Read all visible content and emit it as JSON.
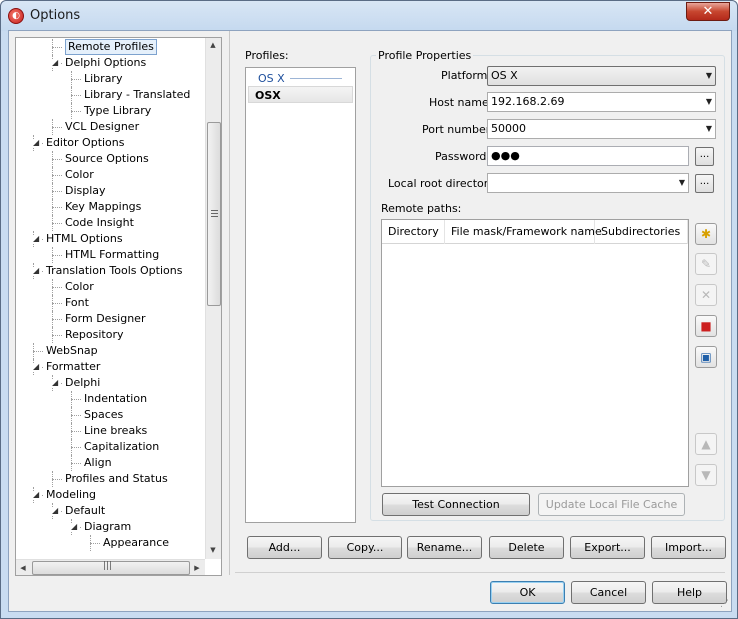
{
  "window": {
    "title": "Options",
    "app_icon": "delphi-logo-icon",
    "close_glyph": "✕"
  },
  "tree": {
    "items": [
      {
        "label": "Remote Profiles",
        "level": 2,
        "toggle": "",
        "selected": true
      },
      {
        "label": "Delphi Options",
        "level": 2,
        "toggle": "expanded"
      },
      {
        "label": "Library",
        "level": 3,
        "toggle": ""
      },
      {
        "label": "Library - Translated",
        "level": 3,
        "toggle": ""
      },
      {
        "label": "Type Library",
        "level": 3,
        "toggle": ""
      },
      {
        "label": "VCL Designer",
        "level": 2,
        "toggle": ""
      },
      {
        "label": "Editor Options",
        "level": 1,
        "toggle": "expanded"
      },
      {
        "label": "Source Options",
        "level": 2,
        "toggle": ""
      },
      {
        "label": "Color",
        "level": 2,
        "toggle": ""
      },
      {
        "label": "Display",
        "level": 2,
        "toggle": ""
      },
      {
        "label": "Key Mappings",
        "level": 2,
        "toggle": ""
      },
      {
        "label": "Code Insight",
        "level": 2,
        "toggle": ""
      },
      {
        "label": "HTML Options",
        "level": 1,
        "toggle": "expanded"
      },
      {
        "label": "HTML Formatting",
        "level": 2,
        "toggle": ""
      },
      {
        "label": "Translation Tools Options",
        "level": 1,
        "toggle": "expanded"
      },
      {
        "label": "Color",
        "level": 2,
        "toggle": ""
      },
      {
        "label": "Font",
        "level": 2,
        "toggle": ""
      },
      {
        "label": "Form Designer",
        "level": 2,
        "toggle": ""
      },
      {
        "label": "Repository",
        "level": 2,
        "toggle": ""
      },
      {
        "label": "WebSnap",
        "level": 1,
        "toggle": ""
      },
      {
        "label": "Formatter",
        "level": 1,
        "toggle": "expanded"
      },
      {
        "label": "Delphi",
        "level": 2,
        "toggle": "expanded"
      },
      {
        "label": "Indentation",
        "level": 3,
        "toggle": ""
      },
      {
        "label": "Spaces",
        "level": 3,
        "toggle": ""
      },
      {
        "label": "Line breaks",
        "level": 3,
        "toggle": ""
      },
      {
        "label": "Capitalization",
        "level": 3,
        "toggle": ""
      },
      {
        "label": "Align",
        "level": 3,
        "toggle": ""
      },
      {
        "label": "Profiles and Status",
        "level": 2,
        "toggle": ""
      },
      {
        "label": "Modeling",
        "level": 1,
        "toggle": "expanded"
      },
      {
        "label": "Default",
        "level": 2,
        "toggle": "expanded"
      },
      {
        "label": "Diagram",
        "level": 3,
        "toggle": "expanded"
      },
      {
        "label": "Appearance",
        "level": 4,
        "toggle": ""
      }
    ],
    "scroll_grip": "|||"
  },
  "profiles": {
    "label": "Profiles:",
    "items": [
      {
        "label": "OS X",
        "style": "group-header"
      },
      {
        "label": "OSX",
        "style": "selected"
      }
    ]
  },
  "properties": {
    "group_title": "Profile Properties",
    "platform": {
      "label": "Platform:",
      "value": "OS X"
    },
    "host_name": {
      "label": "Host name:",
      "value": "192.168.2.69"
    },
    "port_number": {
      "label": "Port number:",
      "value": "50000"
    },
    "password": {
      "label": "Password:",
      "value": "●●●"
    },
    "local_root": {
      "label": "Local root directory:",
      "value": ""
    },
    "browse_label": "...",
    "remote_paths": {
      "label": "Remote paths:",
      "columns": [
        "Directory",
        "File mask/Framework name",
        "Subdirectories"
      ]
    },
    "test_connection": "Test Connection",
    "update_cache": "Update Local File Cache"
  },
  "side_buttons": [
    {
      "icon": "add-path-icon",
      "glyph": "✱",
      "enabled": true,
      "color": "#d8a000"
    },
    {
      "icon": "edit-path-icon",
      "glyph": "✎",
      "enabled": false,
      "color": "#b8b8b8"
    },
    {
      "icon": "delete-path-icon",
      "glyph": "✕",
      "enabled": false,
      "color": "#b8b8b8"
    },
    {
      "icon": "stop-icon",
      "glyph": "■",
      "enabled": true,
      "color": "#cc1f1f"
    },
    {
      "icon": "save-icon",
      "glyph": "▣",
      "enabled": true,
      "color": "#1f5fa8"
    },
    {
      "icon": "move-up-icon",
      "glyph": "▲",
      "enabled": false,
      "color": "#b8b8b8"
    },
    {
      "icon": "move-down-icon",
      "glyph": "▼",
      "enabled": false,
      "color": "#b8b8b8"
    }
  ],
  "profile_buttons": [
    "Add...",
    "Copy...",
    "Rename...",
    "Delete",
    "Export...",
    "Import..."
  ],
  "dialog_buttons": {
    "ok": "OK",
    "cancel": "Cancel",
    "help": "Help"
  }
}
